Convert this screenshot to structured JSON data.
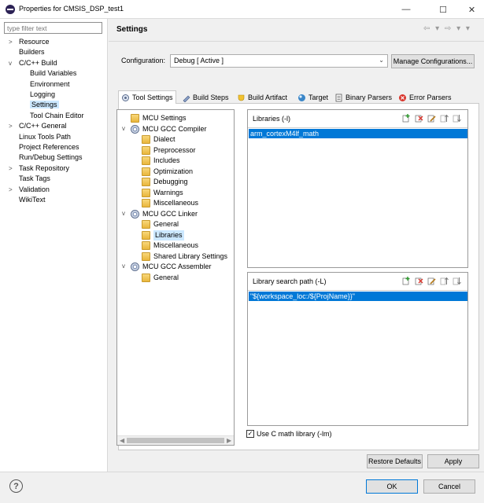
{
  "window": {
    "title": "Properties for CMSIS_DSP_test1",
    "minimize": "—",
    "maximize": "☐",
    "close": "✕"
  },
  "filter": {
    "placeholder": "type filter text"
  },
  "nav": {
    "items": [
      {
        "label": "Resource",
        "expand": ">"
      },
      {
        "label": "Builders"
      },
      {
        "label": "C/C++ Build",
        "expand": "v"
      },
      {
        "label": "Build Variables"
      },
      {
        "label": "Environment"
      },
      {
        "label": "Logging"
      },
      {
        "label": "Settings"
      },
      {
        "label": "Tool Chain Editor"
      },
      {
        "label": "C/C++ General",
        "expand": ">"
      },
      {
        "label": "Linux Tools Path"
      },
      {
        "label": "Project References"
      },
      {
        "label": "Run/Debug Settings"
      },
      {
        "label": "Task Repository",
        "expand": ">"
      },
      {
        "label": "Task Tags"
      },
      {
        "label": "Validation",
        "expand": ">"
      },
      {
        "label": "WikiText"
      }
    ]
  },
  "page": {
    "title": "Settings",
    "nav_arrows": "⇦ ▾ ⇨ ▾ ▾"
  },
  "config": {
    "label": "Configuration:",
    "value": "Debug  [ Active ]",
    "manage_label": "Manage Configurations..."
  },
  "tabs": [
    {
      "label": "Tool Settings",
      "icon": "tool-settings-icon",
      "active": true
    },
    {
      "label": "Build Steps",
      "icon": "build-steps-icon"
    },
    {
      "label": "Build Artifact",
      "icon": "build-artifact-icon"
    },
    {
      "label": "Target",
      "icon": "target-icon"
    },
    {
      "label": "Binary Parsers",
      "icon": "binary-parsers-icon"
    },
    {
      "label": "Error Parsers",
      "icon": "error-parsers-icon"
    }
  ],
  "tree": {
    "items": [
      {
        "label": "MCU Settings"
      },
      {
        "label": "MCU GCC Compiler"
      },
      {
        "label": "Dialect"
      },
      {
        "label": "Preprocessor"
      },
      {
        "label": "Includes"
      },
      {
        "label": "Optimization"
      },
      {
        "label": "Debugging"
      },
      {
        "label": "Warnings"
      },
      {
        "label": "Miscellaneous"
      },
      {
        "label": "MCU GCC Linker"
      },
      {
        "label": "General"
      },
      {
        "label": "Libraries"
      },
      {
        "label": "Miscellaneous"
      },
      {
        "label": "Shared Library Settings"
      },
      {
        "label": "MCU GCC Assembler"
      },
      {
        "label": "General"
      }
    ]
  },
  "libraries": {
    "title": "Libraries (-l)",
    "items": [
      "arm_cortexM4lf_math"
    ]
  },
  "library_paths": {
    "title": "Library search path (-L)",
    "items": [
      "\"${workspace_loc:/${ProjName}}\""
    ]
  },
  "use_c_math": {
    "label": "Use C math library (-lm)",
    "checked": true,
    "mark": "✓"
  },
  "buttons": {
    "restore_defaults": "Restore Defaults",
    "apply": "Apply",
    "ok": "OK",
    "cancel": "Cancel",
    "help": "?"
  }
}
